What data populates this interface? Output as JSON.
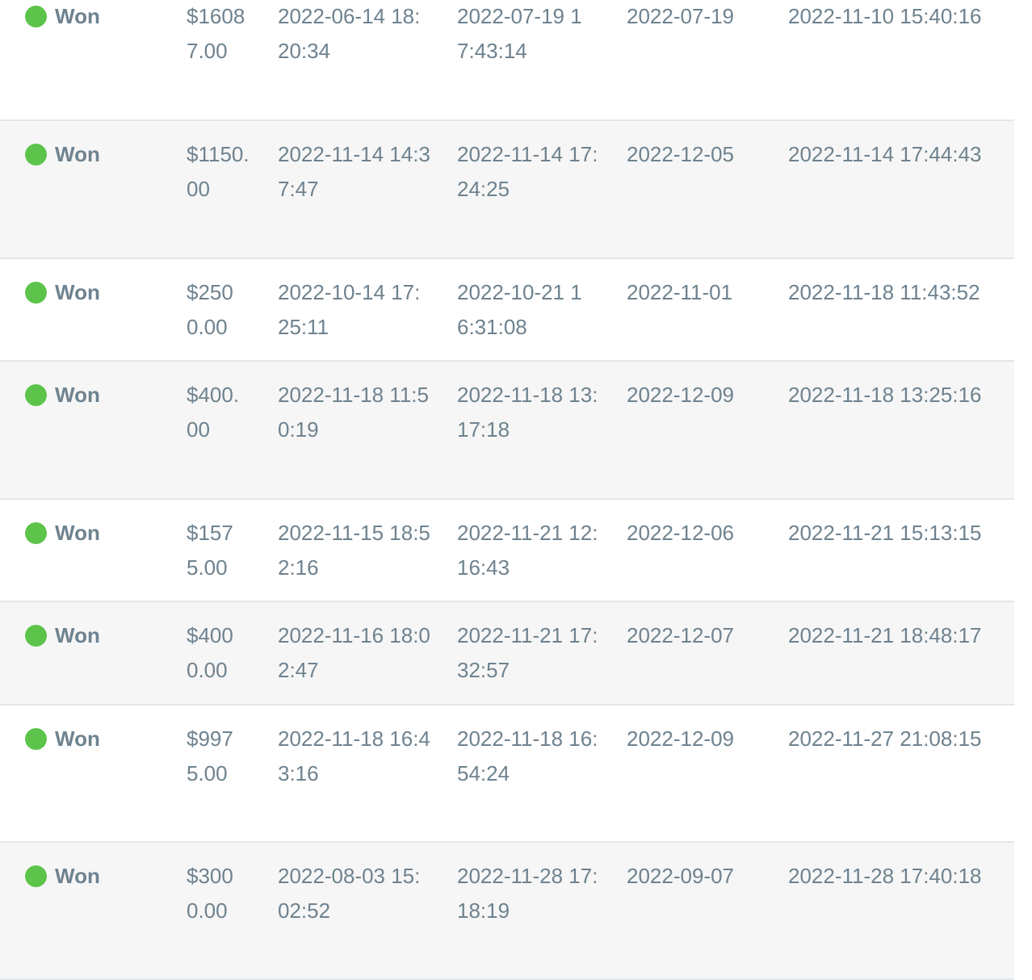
{
  "rows": [
    {
      "status": "Won",
      "amount": "$16087.00",
      "created": "2022-06-14 18:20:34",
      "closed": "2022-07-19 17:43:14",
      "expected": "2022-07-19",
      "updated": "2022-11-10 15:40:16"
    },
    {
      "status": "Won",
      "amount": "$1150.00",
      "created": "2022-11-14 14:37:47",
      "closed": "2022-11-14 17:24:25",
      "expected": "2022-12-05",
      "updated": "2022-11-14 17:44:43"
    },
    {
      "status": "Won",
      "amount": "$2500.00",
      "created": "2022-10-14 17:25:11",
      "closed": "2022-10-21 16:31:08",
      "expected": "2022-11-01",
      "updated": "2022-11-18 11:43:52"
    },
    {
      "status": "Won",
      "amount": "$400.00",
      "created": "2022-11-18 11:50:19",
      "closed": "2022-11-18 13:17:18",
      "expected": "2022-12-09",
      "updated": "2022-11-18 13:25:16"
    },
    {
      "status": "Won",
      "amount": "$1575.00",
      "created": "2022-11-15 18:52:16",
      "closed": "2022-11-21 12:16:43",
      "expected": "2022-12-06",
      "updated": "2022-11-21 15:13:15"
    },
    {
      "status": "Won",
      "amount": "$4000.00",
      "created": "2022-11-16 18:02:47",
      "closed": "2022-11-21 17:32:57",
      "expected": "2022-12-07",
      "updated": "2022-11-21 18:48:17"
    },
    {
      "status": "Won",
      "amount": "$9975.00",
      "created": "2022-11-18 16:43:16",
      "closed": "2022-11-18 16:54:24",
      "expected": "2022-12-09",
      "updated": "2022-11-27 21:08:15"
    },
    {
      "status": "Won",
      "amount": "$3000.00",
      "created": "2022-08-03 15:02:52",
      "closed": "2022-11-28 17:18:19",
      "expected": "2022-09-07",
      "updated": "2022-11-28 17:40:18"
    }
  ],
  "colors": {
    "status_dot": "#5cc44a",
    "text": "#6e828f",
    "row_alt_bg": "#f6f6f6",
    "divider": "#e3e6e9"
  }
}
